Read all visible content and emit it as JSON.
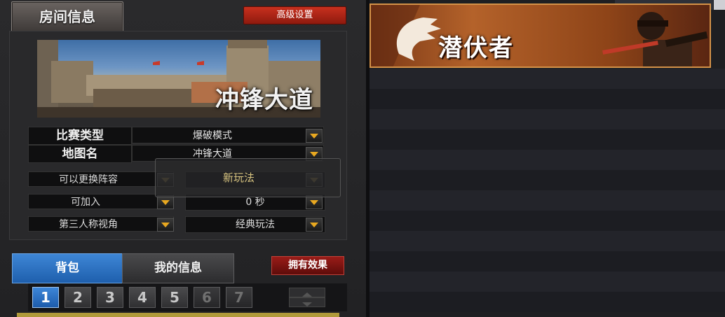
{
  "room_info": {
    "title": "房间信息",
    "advanced_settings_label": "高级设置",
    "map_preview_name": "冲锋大道",
    "match_type": {
      "label": "比赛类型",
      "value": "爆破模式"
    },
    "map_name": {
      "label": "地图名",
      "value": "冲锋大道"
    },
    "options": [
      {
        "value": "可以更换阵容"
      },
      {
        "value": ""
      },
      {
        "value": "可加入"
      },
      {
        "value": "0 秒"
      },
      {
        "value": "第三人称视角"
      },
      {
        "value": "经典玩法"
      }
    ],
    "tooltip": "新玩法"
  },
  "bottom_tabs": {
    "bag": "背包",
    "my_info": "我的信息",
    "effect_button": "拥有效果"
  },
  "slots": [
    "1",
    "2",
    "3",
    "4",
    "5",
    "6",
    "7"
  ],
  "banner": {
    "title": "潜伏者"
  },
  "colors": {
    "accent_blue": "#1e5fad",
    "accent_red": "#b8281a",
    "dropdown_arrow": "#e8a820",
    "banner_orange": "#b4622a"
  }
}
